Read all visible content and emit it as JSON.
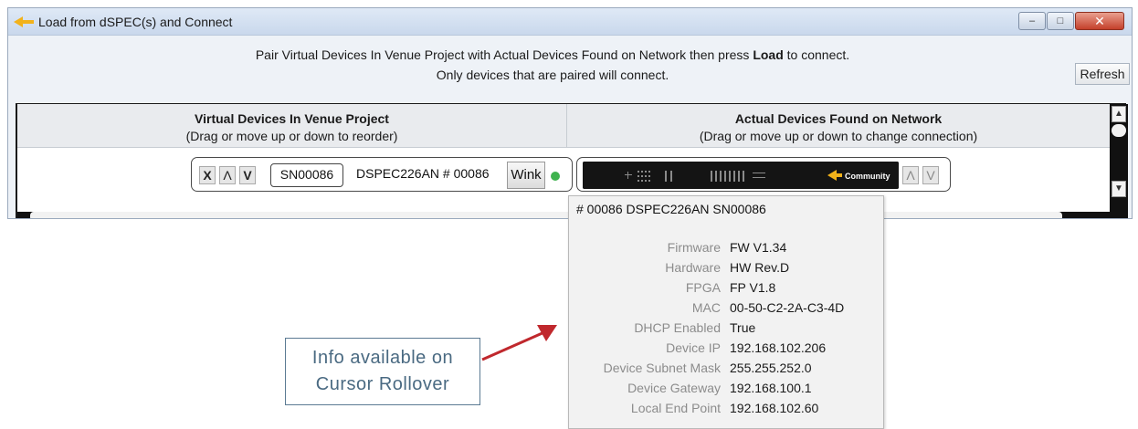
{
  "window": {
    "title": "Load from dSPEC(s) and Connect",
    "controls": {
      "minimize": "–",
      "maximize": "□",
      "close": "✕"
    }
  },
  "instructions": {
    "line1_pre": "Pair Virtual Devices In Venue Project with Actual Devices Found on Network then press ",
    "line1_bold": "Load",
    "line1_post": " to connect.",
    "line2": "Only devices that are paired will connect."
  },
  "refresh_label": "Refresh",
  "columns": {
    "virtual": {
      "title": "Virtual Devices In Venue Project",
      "subtitle": "(Drag or move up or down to reorder)"
    },
    "actual": {
      "title": "Actual Devices Found on Network",
      "subtitle": "(Drag or move up or down to change connection)"
    }
  },
  "virtual_device": {
    "remove_label": "X",
    "up_label": "Λ",
    "down_label": "V",
    "serial": "SN00086",
    "name": "DSPEC226AN # 00086",
    "wink_label": "Wink",
    "status_color": "#3fb34f"
  },
  "actual_device": {
    "brand": "Community",
    "up_label": "Λ",
    "down_label": "V"
  },
  "tooltip": {
    "header": "# 00086 DSPEC226AN   SN00086",
    "rows": [
      {
        "label": "Firmware",
        "value": "FW V1.34"
      },
      {
        "label": "Hardware",
        "value": "HW Rev.D"
      },
      {
        "label": "FPGA",
        "value": "FP V1.8"
      },
      {
        "label": "MAC",
        "value": "00-50-C2-2A-C3-4D"
      },
      {
        "label": "DHCP Enabled",
        "value": "True"
      },
      {
        "label": "Device IP",
        "value": "192.168.102.206"
      },
      {
        "label": "Device Subnet Mask",
        "value": "255.255.252.0"
      },
      {
        "label": "Device Gateway",
        "value": "192.168.100.1"
      },
      {
        "label": "Local End Point",
        "value": "192.168.102.60"
      }
    ]
  },
  "callout": {
    "line1": "Info available on",
    "line2": "Cursor Rollover"
  },
  "colors": {
    "arrow": "#c0282d",
    "brand_accent": "#f2b21a"
  }
}
